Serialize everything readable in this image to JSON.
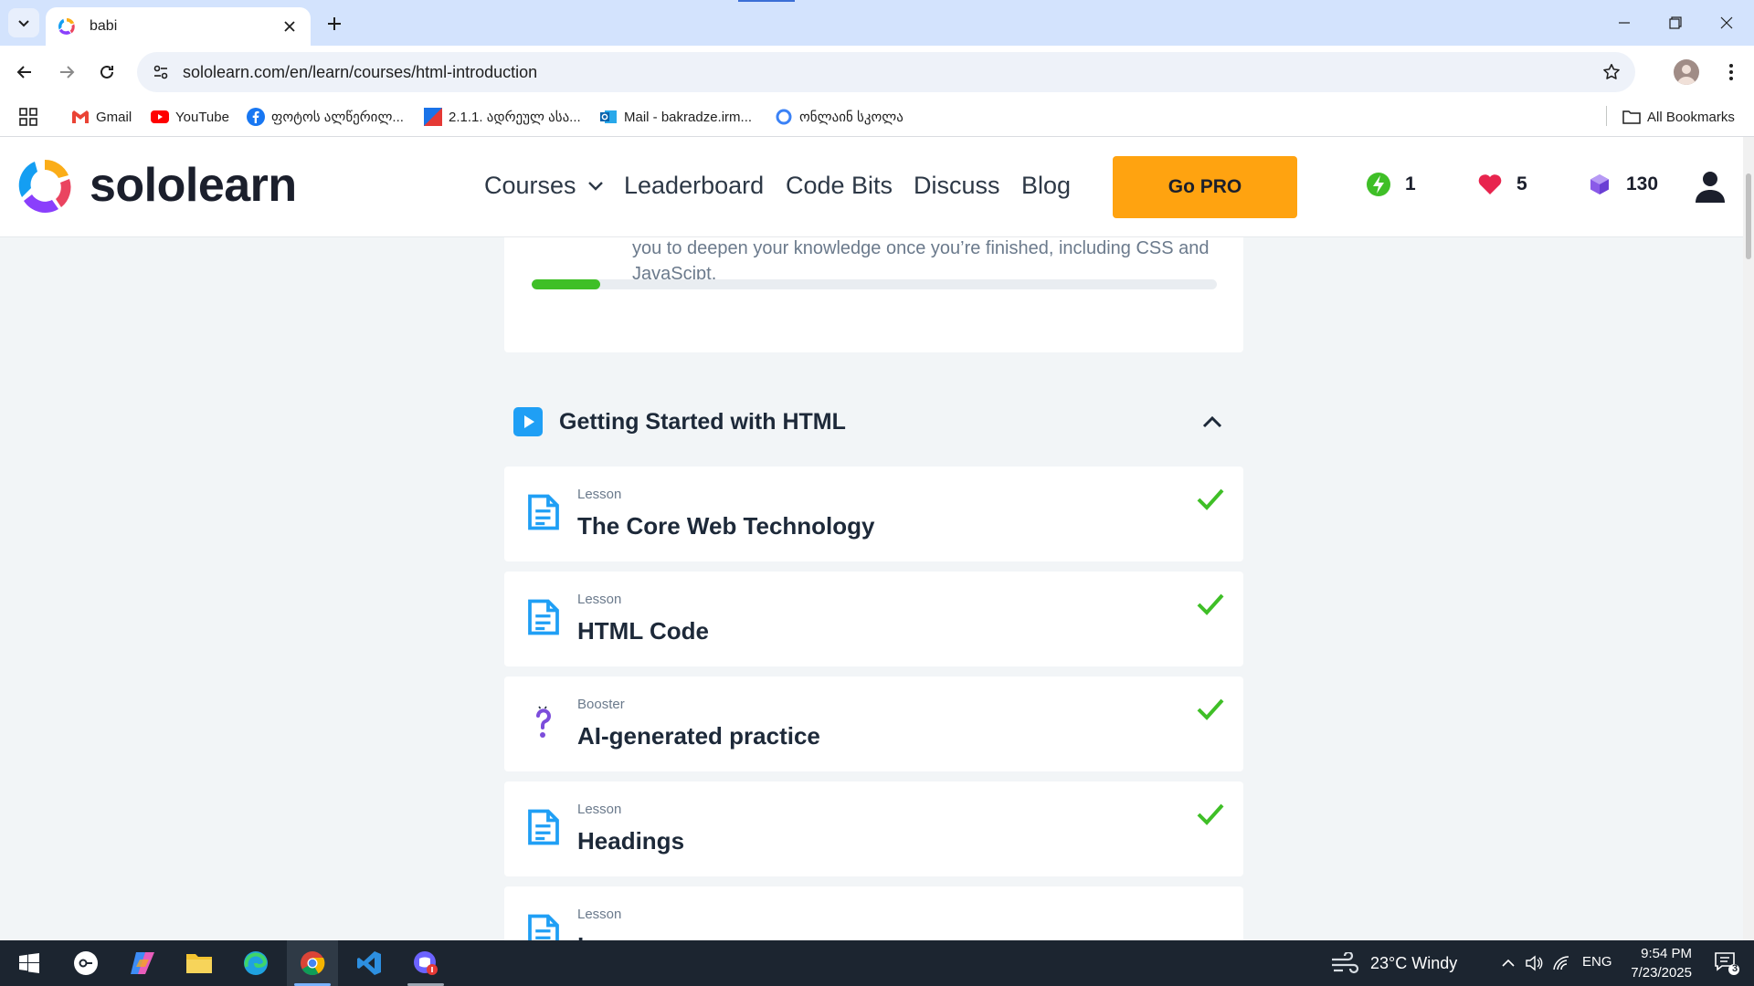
{
  "browser": {
    "tab_title": "babi",
    "url": "sololearn.com/en/learn/courses/html-introduction",
    "bookmarks": [
      {
        "label": "Gmail",
        "icon": "gmail-icon"
      },
      {
        "label": "YouTube",
        "icon": "youtube-icon"
      },
      {
        "label": "ფოტოს ალწერილ...",
        "icon": "facebook-icon"
      },
      {
        "label": "2.1.1. ადრეულ ასა...",
        "icon": "document-icon"
      },
      {
        "label": "Mail - bakradze.irm...",
        "icon": "outlook-icon"
      },
      {
        "label": "ონლაინ სკოლა",
        "icon": "circle-icon"
      }
    ],
    "all_bookmarks_label": "All Bookmarks"
  },
  "header": {
    "logo_text": "sololearn",
    "nav": {
      "courses": "Courses",
      "leaderboard": "Leaderboard",
      "code_bits": "Code Bits",
      "discuss": "Discuss",
      "blog": "Blog"
    },
    "go_pro": "Go PRO",
    "streak": "1",
    "hearts": "5",
    "gems": "130"
  },
  "course": {
    "description": "you to deepen your knowledge once you’re finished, including CSS and JavaScipt.",
    "progress_fraction": 0.1,
    "module_title": "Getting Started with HTML",
    "lessons": [
      {
        "kind": "Lesson",
        "name": "The Core Web Technology",
        "completed": true,
        "icon": "lesson-doc-icon"
      },
      {
        "kind": "Lesson",
        "name": "HTML Code",
        "completed": true,
        "icon": "lesson-doc-icon"
      },
      {
        "kind": "Booster",
        "name": "AI-generated practice",
        "completed": true,
        "icon": "booster-question-icon"
      },
      {
        "kind": "Lesson",
        "name": "Headings",
        "completed": true,
        "icon": "lesson-doc-icon"
      },
      {
        "kind": "Lesson",
        "name": "Images",
        "completed": false,
        "icon": "lesson-doc-icon"
      }
    ]
  },
  "colors": {
    "accent_orange": "#ffa310",
    "progress_green": "#3fbf27",
    "check_green": "#3fbf27",
    "lesson_blue": "#1f9ff5",
    "booster_purple": "#7c4ddb"
  },
  "taskbar": {
    "weather": "23°C  Windy",
    "language": "ENG",
    "time": "9:54 PM",
    "date": "7/23/2025",
    "notification_count": "3"
  }
}
